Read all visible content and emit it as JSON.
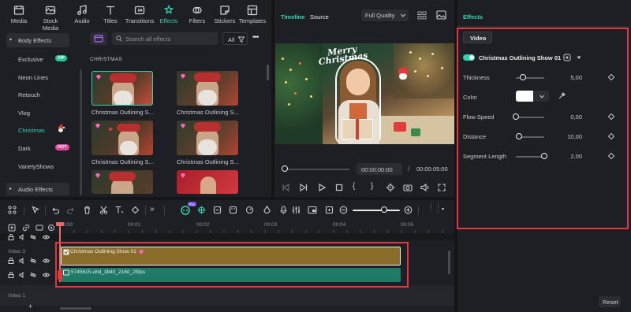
{
  "toolbar": {
    "tabs": [
      {
        "label": "Media",
        "icon": "media-icon"
      },
      {
        "label": "Stock Media",
        "icon": "stock-media-icon"
      },
      {
        "label": "Audio",
        "icon": "audio-icon"
      },
      {
        "label": "Titles",
        "icon": "titles-icon"
      },
      {
        "label": "Transitions",
        "icon": "transitions-icon"
      },
      {
        "label": "Effects",
        "icon": "effects-icon"
      },
      {
        "label": "Filters",
        "icon": "filters-icon"
      },
      {
        "label": "Stickers",
        "icon": "stickers-icon"
      },
      {
        "label": "Templates",
        "icon": "templates-icon"
      }
    ],
    "active_tab": "Effects"
  },
  "sidebar": {
    "section": "Body Effects",
    "items": [
      {
        "label": "Exclusive",
        "badge": "VIP"
      },
      {
        "label": "Neon Lines"
      },
      {
        "label": "Retouch"
      },
      {
        "label": "Vlog"
      },
      {
        "label": "Christmas"
      },
      {
        "label": "Dark",
        "badge": "HOT"
      },
      {
        "label": "VarietyShows"
      }
    ],
    "footer_section": "Audio Effects"
  },
  "library": {
    "search_placeholder": "Search all effects",
    "filter_label": "All",
    "group_title": "CHRISTMAS",
    "captions": [
      "Christmas Outlining S...",
      "Christmas Outlining S...",
      "Christmas Outlining S...",
      "Christmas Outlining S..."
    ]
  },
  "preview": {
    "tabs": [
      "Timeline",
      "Source"
    ],
    "quality": "Full Quality",
    "video_overlay_text": [
      "Merry",
      "Christmas"
    ],
    "current_time": "00:00:00:00",
    "separator": "/",
    "total_time": "00:00:05:00"
  },
  "properties": {
    "panel_title": "Effects",
    "tab": "Video",
    "effect_name": "Christmas Outlining Show 01",
    "params": [
      {
        "label": "Thickness",
        "value": "5,00",
        "level": 0.25
      },
      {
        "label": "Color"
      },
      {
        "label": "Flow Speed",
        "value": "0,00",
        "level": 0.0
      },
      {
        "label": "Distance",
        "value": "10,00",
        "level": 0.1
      },
      {
        "label": "Segment Length",
        "value": "2,00",
        "level": 1.0
      }
    ],
    "color_swatch": "#ffffff",
    "reset_label": "Reset"
  },
  "timeline": {
    "ruler": [
      "00:00",
      "00:01",
      "00:02",
      "00:03",
      "00:04",
      "00:05"
    ],
    "tracks": [
      {
        "label": "Video 3"
      },
      {
        "label": "Video 1"
      }
    ],
    "clips": {
      "effect": "Christmas Outlining Show 01",
      "video": "5745615-uhd_3840_2160_25fps"
    },
    "ai_badge": "Pro"
  },
  "colors": {
    "accent": "#2fd3b4",
    "effect_clip": "#8a6d2a",
    "video_clip": "#1f7a66",
    "highlight": "#e0383e"
  }
}
